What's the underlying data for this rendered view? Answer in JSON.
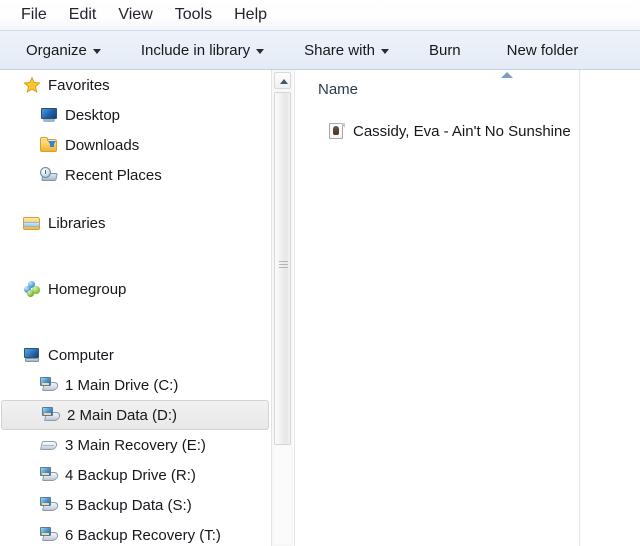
{
  "menubar": {
    "items": [
      {
        "label": "File",
        "name": "menu-file"
      },
      {
        "label": "Edit",
        "name": "menu-edit"
      },
      {
        "label": "View",
        "name": "menu-view"
      },
      {
        "label": "Tools",
        "name": "menu-tools"
      },
      {
        "label": "Help",
        "name": "menu-help"
      }
    ]
  },
  "toolbar": {
    "organize_label": "Organize",
    "include_label": "Include in library",
    "share_label": "Share with",
    "burn_label": "Burn",
    "new_folder_label": "New folder"
  },
  "navigation": {
    "groups": [
      {
        "header": {
          "label": "Favorites",
          "icon": "star-icon"
        },
        "items": [
          {
            "label": "Desktop",
            "icon": "desktop-monitor-icon"
          },
          {
            "label": "Downloads",
            "icon": "downloads-folder-icon"
          },
          {
            "label": "Recent Places",
            "icon": "recent-places-icon"
          }
        ]
      },
      {
        "header": {
          "label": "Libraries",
          "icon": "libraries-folder-icon"
        },
        "items": []
      },
      {
        "header": {
          "label": "Homegroup",
          "icon": "homegroup-icon"
        },
        "items": []
      },
      {
        "header": {
          "label": "Computer",
          "icon": "computer-icon"
        },
        "items": [
          {
            "label": "1 Main Drive (C:)",
            "icon": "network-drive-icon",
            "selected": false
          },
          {
            "label": "2 Main Data (D:)",
            "icon": "network-drive-icon",
            "selected": true
          },
          {
            "label": "3 Main Recovery (E:)",
            "icon": "hard-drive-icon",
            "selected": false
          },
          {
            "label": "4 Backup Drive (R:)",
            "icon": "network-drive-icon",
            "selected": false
          },
          {
            "label": "5 Backup Data (S:)",
            "icon": "network-drive-icon",
            "selected": false
          },
          {
            "label": "6 Backup Recovery (T:)",
            "icon": "network-drive-icon",
            "selected": false
          }
        ]
      }
    ]
  },
  "scrollbar": {
    "up_arrow": "scroll-up-arrow-icon",
    "grip": "scrollbar-grip-icon"
  },
  "filelist": {
    "column_header": "Name",
    "sort_indicator": "sort-ascending-icon",
    "rows": [
      {
        "name": "Cassidy, Eva - Ain't No Sunshine",
        "icon": "audio-file-icon"
      }
    ]
  },
  "colors": {
    "toolbar_bg": "#e9eff8",
    "selection_bg": "#ececec",
    "selection_border": "#d3d3d3",
    "header_text": "#2b3b4e",
    "body_text": "#14171c"
  }
}
